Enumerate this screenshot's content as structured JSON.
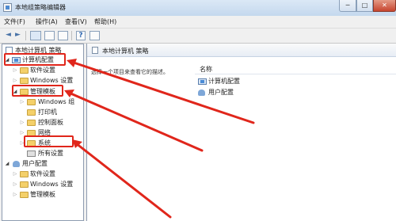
{
  "window": {
    "title": "本地组策略编辑器"
  },
  "window_controls": {
    "minimize": "─",
    "maximize": "□",
    "close": "✕"
  },
  "menu": [
    {
      "label": "文件(F)"
    },
    {
      "label": "操作(A)"
    },
    {
      "label": "查看(V)"
    },
    {
      "label": "帮助(H)"
    }
  ],
  "toolbar": {
    "back": "◄",
    "forward": "►"
  },
  "tree": {
    "root": {
      "label": "本地计算机 策略",
      "icon": "policy-doc-icon"
    },
    "computer_config": {
      "label": "计算机配置",
      "icon": "computer-icon"
    },
    "software_settings": {
      "label": "软件设置"
    },
    "windows_settings": {
      "label": "Windows 设置"
    },
    "admin_templates": {
      "label": "管理模板"
    },
    "admin_children": [
      {
        "label": "Windows 组"
      },
      {
        "label": "打印机"
      },
      {
        "label": "控制面板"
      },
      {
        "label": "网络"
      },
      {
        "label": "系统"
      },
      {
        "label": "所有设置"
      }
    ],
    "user_config": {
      "label": "用户配置",
      "icon": "user-icon"
    },
    "user_children": [
      {
        "label": "软件设置"
      },
      {
        "label": "Windows 设置"
      },
      {
        "label": "管理模板"
      }
    ]
  },
  "right_pane": {
    "header_title": "本地计算机 策略",
    "description": "选择一个项目来查看它的描述。",
    "column_name": "名称",
    "items": [
      {
        "label": "计算机配置",
        "icon": "computer-icon"
      },
      {
        "label": "用户配置",
        "icon": "user-icon"
      }
    ]
  },
  "annotation": {
    "color": "#e0261b"
  }
}
